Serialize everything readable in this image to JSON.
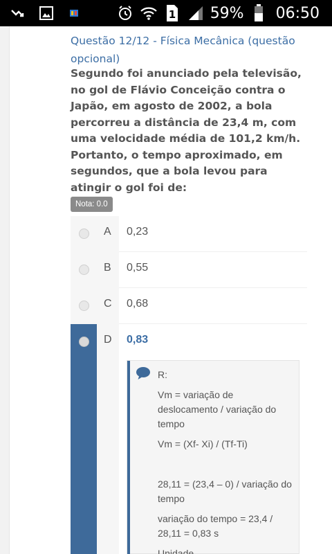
{
  "status_bar": {
    "battery": "59%",
    "time": "06:50",
    "icons": [
      "missed-call-icon",
      "gallery-icon",
      "app-icon",
      "alarm-icon",
      "wifi-icon",
      "sim1-icon",
      "signal-icon",
      "battery-icon"
    ],
    "sim_slot": "1"
  },
  "question": {
    "title": "Questão 12/12 - Física Mecânica (questão opcional)",
    "text": "Segundo foi anunciado pela televisão, no gol de Flávio Conceição contra o Japão, em agosto de 2002, a bola percorreu a distância de 23,4 m, com uma velocidade média de 101,2 km/h. Portanto, o tempo aproximado, em segundos, que a bola levou para atingir o gol foi de:",
    "grade": "Nota: 0.0"
  },
  "options": [
    {
      "letter": "A",
      "text": "0,23"
    },
    {
      "letter": "B",
      "text": "0,55"
    },
    {
      "letter": "C",
      "text": "0,68"
    },
    {
      "letter": "D",
      "text": "0,83"
    }
  ],
  "feedback": {
    "lines": [
      "R:",
      "Vm = variação de deslocamento / variação do tempo",
      "Vm = (Xf- Xi) / (Tf-Ti)",
      "",
      "28,11 =  (23,4 – 0) / variação do tempo",
      "variação do tempo = 23,4 / 28,11 = 0,83 s",
      "Unidade"
    ]
  },
  "colors": {
    "accent": "#3e6a9a",
    "title": "#3c6ea5",
    "grade_badge": "#8a8a8a"
  }
}
